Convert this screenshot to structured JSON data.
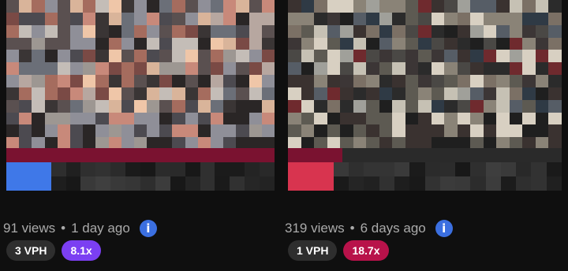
{
  "videos": [
    {
      "views": "91 views",
      "separator": "•",
      "age": "1 day ago",
      "info_icon": "info-icon",
      "vph": "3 VPH",
      "ratio": "8.1x",
      "ratio_color": "#7b3ff2",
      "progress_color": "#7a1230",
      "progress_fraction": 1.0
    },
    {
      "views": "319 views",
      "separator": "•",
      "age": "6 days ago",
      "info_icon": "info-icon",
      "vph": "1 VPH",
      "ratio": "18.7x",
      "ratio_color": "#b8124a",
      "progress_color": "#7a1230",
      "progress_fraction": 0.2
    }
  ]
}
